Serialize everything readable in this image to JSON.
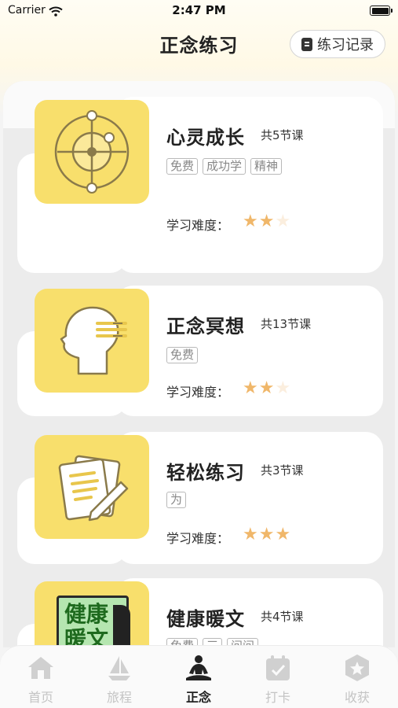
{
  "status_bar": {
    "carrier": "Carrier",
    "time": "2:47 PM"
  },
  "header": {
    "title": "正念练习",
    "record_button": "练习记录"
  },
  "courses": [
    {
      "title": "心灵成长",
      "count": "共5节课",
      "tags": [
        "免费",
        "成功学",
        "精神"
      ],
      "difficulty_label": "学习难度：",
      "stars": 2,
      "thumb_icon": "compass-target-icon"
    },
    {
      "title": "正念冥想",
      "count": "共13节课",
      "tags": [
        "免费"
      ],
      "difficulty_label": "学习难度：",
      "stars": 2,
      "thumb_icon": "meditation-head-icon"
    },
    {
      "title": "轻松练习",
      "count": "共3节课",
      "tags": [
        "为"
      ],
      "difficulty_label": "学习难度：",
      "stars": 3,
      "thumb_icon": "notes-pencil-icon"
    },
    {
      "title": "健康暖文",
      "count": "共4节课",
      "tags": [
        "免费",
        "三",
        "问问"
      ],
      "thumb_text": "健康暖文",
      "thumb_icon": "book-cover-icon"
    }
  ],
  "tabbar": {
    "items": [
      {
        "label": "首页",
        "icon": "home-icon",
        "active": false
      },
      {
        "label": "旅程",
        "icon": "sailboat-icon",
        "active": false
      },
      {
        "label": "正念",
        "icon": "meditation-icon",
        "active": true
      },
      {
        "label": "打卡",
        "icon": "calendar-check-icon",
        "active": false
      },
      {
        "label": "收获",
        "icon": "star-badge-icon",
        "active": false
      }
    ]
  },
  "colors": {
    "thumb_bg": "#f8df6c",
    "star_on": "#f0b76a",
    "star_off": "#fbeede",
    "tab_active": "#222222",
    "tab_inactive": "#c4c4c4"
  }
}
